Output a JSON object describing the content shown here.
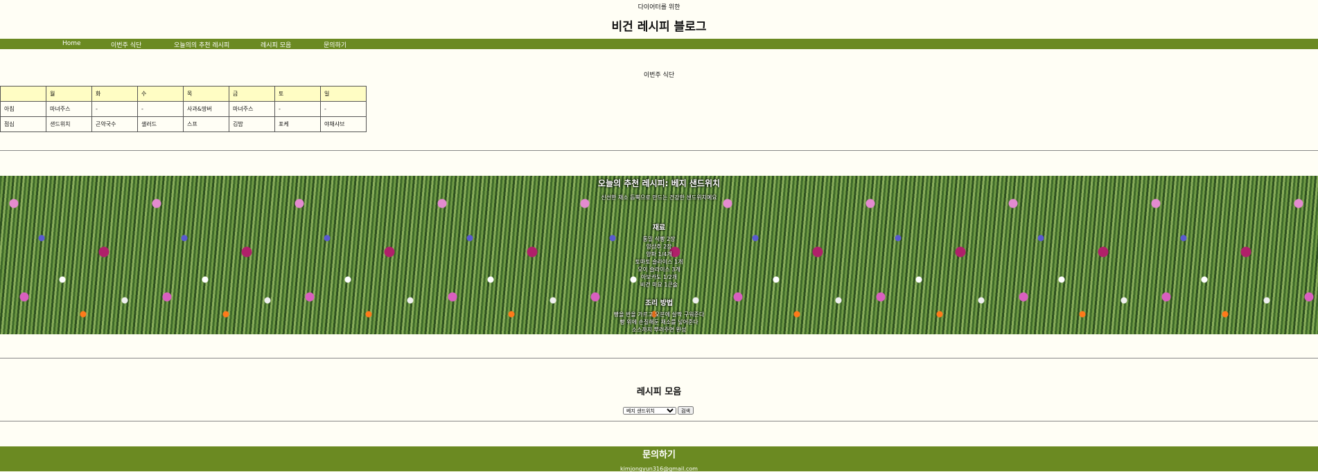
{
  "header": {
    "subtitle": "다이어터를 위한",
    "title": "비건 레시피 블로그"
  },
  "nav": {
    "items": [
      {
        "label": "Home"
      },
      {
        "label": "이번주 식단"
      },
      {
        "label": "오늘의의 추천 레시피"
      },
      {
        "label": "레시피 모음"
      },
      {
        "label": "문의하기"
      }
    ]
  },
  "meal_plan": {
    "heading": "이번주 식단",
    "days": [
      "",
      "월",
      "화",
      "수",
      "목",
      "금",
      "토",
      "일"
    ],
    "rows": [
      {
        "meal": "아침",
        "cells": [
          "마녀주스",
          "-",
          "-",
          "사과&땅버",
          "마녀주스",
          "-",
          "-"
        ]
      },
      {
        "meal": "점심",
        "cells": [
          "샌드위치",
          "곤약국수",
          "샐러드",
          "스프",
          "김밥",
          "포케",
          "야채샤브"
        ]
      }
    ]
  },
  "recipe": {
    "heading": "오늘의 추천 레시피: 베지 샌드위치",
    "description": "신선한 채소 듬뿍으로 만드는 건강한 샌드위치예요",
    "ingredients_heading": "재료",
    "ingredients": [
      "통밀 식빵 2장",
      "양상추 2장",
      "양파 1/4개",
      "토마토 슬라이스 1개",
      "오이 슬라이스 3개",
      "아보카도 1/2개",
      "비건 마요 1큰술"
    ],
    "steps_heading": "조리 방법",
    "steps": [
      "빵을 반을 가르고 오븐에 살짝 구워준다",
      "빵 위에 손질해둔 채소를 넣어준다",
      "소스까지 뿌려주면 완성"
    ]
  },
  "recipe_list": {
    "heading": "레시피 모음",
    "selected": "베지 샌드위치",
    "search_label": "검색"
  },
  "footer": {
    "heading": "문의하기",
    "email": "kimjongyun316@gmail.com"
  },
  "colors": {
    "nav_bg": "#6b8a22",
    "page_bg": "#fffef5",
    "table_header_bg": "#fffdc4"
  }
}
